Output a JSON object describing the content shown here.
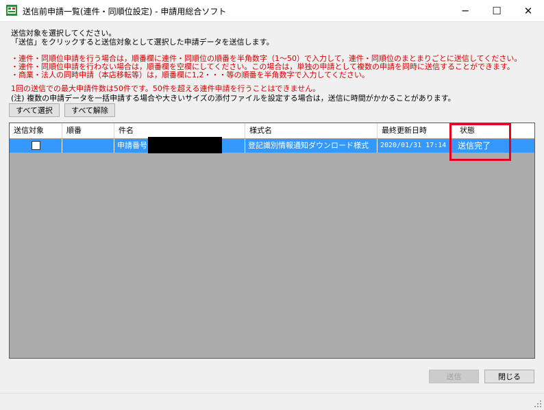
{
  "window": {
    "title": "送信前申請一覧(連件・同順位設定) - 申請用総合ソフト",
    "minimize_glyph": "─",
    "maximize_glyph": "☐",
    "close_glyph": "✕"
  },
  "instructions": {
    "line1": "送信対象を選択してください。",
    "line2": "「送信」をクリックすると送信対象として選択した申請データを送信します。",
    "red1": "・連件・同順位申請を行う場合は，順番欄に連件・同順位の順番を半角数字（1～50）で入力して，連件・同順位のまとまりごとに送信してください。",
    "red2": "・連件・同順位申請を行わない場合は，順番欄を空欄にしてください。この場合は，単独の申請として複数の申請を同時に送信することができます。",
    "red3": "・商業・法人の同時申請（本店移転等）は，順番欄に1,2・・・等の順番を半角数字で入力してください。",
    "red4": "1回の送信での最大申請件数は50件です。50件を超える連件申請を行うことはできません。",
    "note": "(注) 複数の申請データを一括申請する場合や大きいサイズの添付ファイルを設定する場合は，送信に時間がかかることがあります。"
  },
  "buttons": {
    "select_all": "すべて選択",
    "deselect_all": "すべて解除",
    "send": "送信",
    "close": "閉じる"
  },
  "table": {
    "columns": [
      "送信対象",
      "順番",
      "件名",
      "様式名",
      "最終更新日時",
      "状態"
    ],
    "rows": [
      {
        "checked": false,
        "order": "",
        "subject": "申請番号",
        "form_name": "登記識別情報通知ダウンロード様式",
        "updated": "2020/01/31 17:14",
        "status": "送信完了"
      }
    ]
  },
  "colors": {
    "selection": "#3399ff",
    "empty_area": "#ababab",
    "notice_red": "#d40000",
    "highlight_box": "#e8001c"
  }
}
